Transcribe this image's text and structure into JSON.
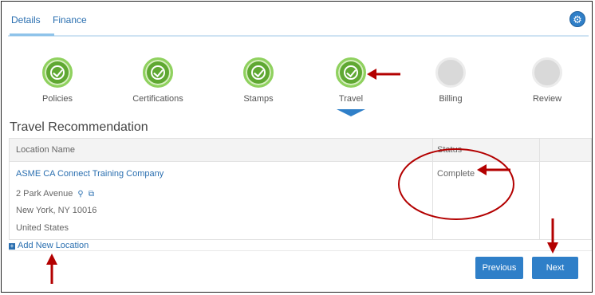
{
  "tabs": [
    {
      "label": "Details",
      "active": true
    },
    {
      "label": "Finance",
      "active": false
    }
  ],
  "settings_icon": "gear-icon",
  "steps": [
    {
      "label": "Policies",
      "state": "complete"
    },
    {
      "label": "Certifications",
      "state": "complete"
    },
    {
      "label": "Stamps",
      "state": "complete"
    },
    {
      "label": "Travel",
      "state": "complete"
    },
    {
      "label": "Billing",
      "state": "pending"
    },
    {
      "label": "Review",
      "state": "pending"
    }
  ],
  "section": {
    "title": "Travel Recommendation"
  },
  "table": {
    "columns": [
      "Location Name",
      "Status"
    ],
    "rows": [
      {
        "name": "ASME CA Connect Training Company",
        "address_line1": "2 Park Avenue",
        "address_line2": "New York, NY 10016",
        "country": "United States",
        "status": "Complete"
      }
    ]
  },
  "add_location": {
    "label": "Add New Location"
  },
  "buttons": {
    "previous": "Previous",
    "next": "Next"
  },
  "colors": {
    "accent": "#2f7fc8",
    "complete": "#5fa832",
    "annotation": "#b30000"
  }
}
